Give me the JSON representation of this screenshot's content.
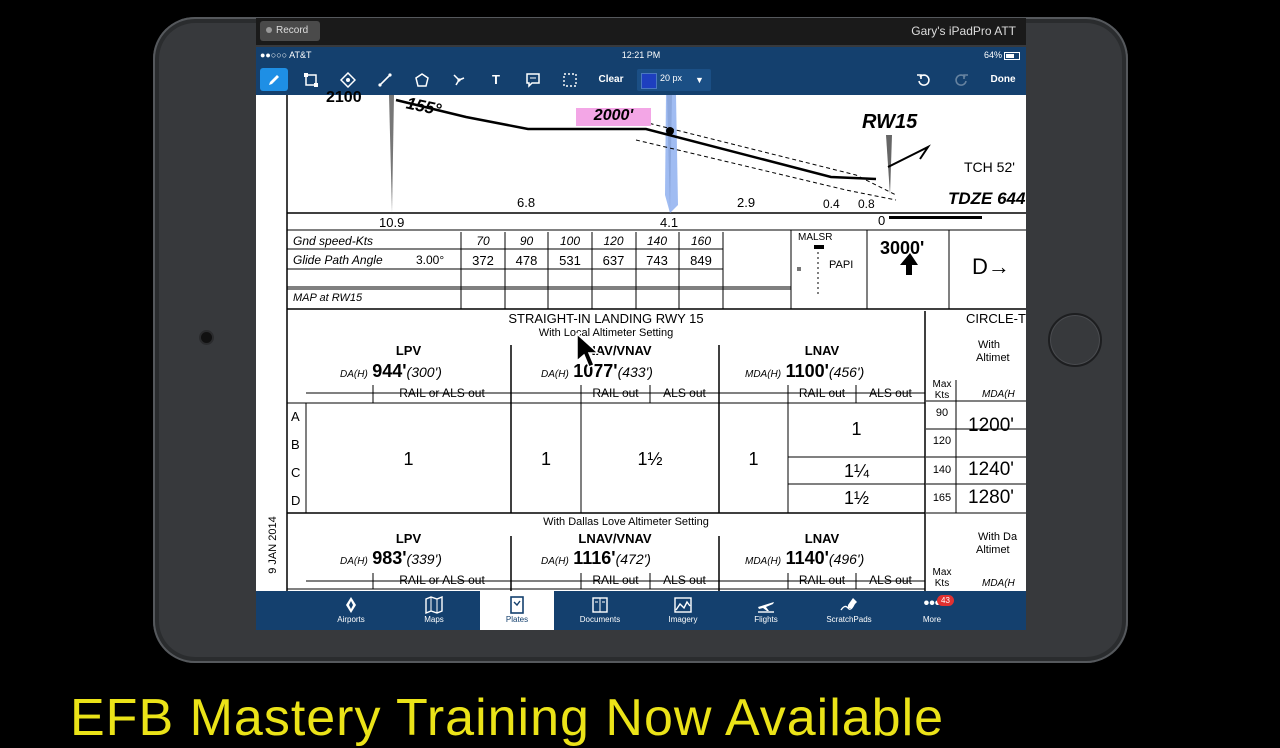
{
  "recorder": {
    "button_label": "Record",
    "device_name": "Gary's iPadPro ATT"
  },
  "status_bar": {
    "carrier": "●●○○○ AT&T",
    "time": "12:21 PM",
    "battery": "64%"
  },
  "toolbar": {
    "clear_label": "Clear",
    "stroke_width": "20 px",
    "done_label": "Done",
    "stroke_color": "#1e3fbf"
  },
  "plate": {
    "profile": {
      "alt_left": "2100",
      "course": "155°",
      "glideslope_alt": "2000'",
      "runway": "RW15",
      "tch": "TCH 52'",
      "tdze": "TDZE 644",
      "dist1": "6.8",
      "dist2": "2.9",
      "dist3": "0.4",
      "dist4": "0.8",
      "mile1": "10.9",
      "mile2": "4.1",
      "mile3": "0"
    },
    "speed_table": {
      "row1_label": "Gnd speed-Kts",
      "speeds": [
        "70",
        "90",
        "100",
        "120",
        "140",
        "160"
      ],
      "row2_label": "Glide Path Angle",
      "angle": "3.00°",
      "rates": [
        "372",
        "478",
        "531",
        "637",
        "743",
        "849"
      ],
      "row3_label": "MAP at RW15"
    },
    "lighting": {
      "malsr": "MALSR",
      "papi": "PAPI"
    },
    "missed_alt": "3000'",
    "straight_in": {
      "title": "STRAIGHT-IN LANDING RWY 15",
      "subtitle": "With Local Altimeter Setting",
      "col_lpv": "LPV",
      "col_lnav_vnav": "LNAV/VNAV",
      "col_lnav": "LNAV",
      "da_h": "DA(H)",
      "mda_h": "MDA(H)",
      "lpv_min": "944'",
      "lpv_hat": "(300')",
      "lnavvnav_min": "1077'",
      "lnavvnav_hat": "(433')",
      "lnav_min": "1100'",
      "lnav_hat": "(456')",
      "rail_or_als": "RAIL or ALS out",
      "rail_out": "RAIL out",
      "als_out": "ALS out",
      "categories": [
        "A",
        "B",
        "C",
        "D"
      ],
      "vis_lpv": "1",
      "vis_lnavvnav_rail": "1",
      "vis_lnavvnav_als": "1½",
      "vis_lnav_rail": "1",
      "vis_lnav_als_ab": "1",
      "vis_lnav_als_c": "1¼",
      "vis_lnav_als_d": "1½"
    },
    "dallas": {
      "subtitle": "With Dallas Love Altimeter Setting",
      "lpv_min": "983'",
      "lpv_hat": "(339')",
      "lnavvnav_min": "1116'",
      "lnavvnav_hat": "(472')",
      "lnav_min": "1140'",
      "lnav_hat": "(496')"
    },
    "circling": {
      "title": "CIRCLE-T",
      "with_local": "With",
      "altimeter": "Altimet",
      "with_dallas": "With Da",
      "max_kts": "Max Kts",
      "mda_h": "MDA(H",
      "speeds": [
        "90",
        "120",
        "140",
        "165"
      ],
      "mins": [
        "1200'",
        "1240'",
        "1280'"
      ]
    },
    "date": "9 JAN 2014"
  },
  "tabs": [
    {
      "label": "Airports"
    },
    {
      "label": "Maps"
    },
    {
      "label": "Plates"
    },
    {
      "label": "Documents"
    },
    {
      "label": "Imagery"
    },
    {
      "label": "Flights"
    },
    {
      "label": "ScratchPads"
    },
    {
      "label": "More",
      "badge": "43"
    }
  ],
  "banner": "EFB Mastery Training Now Available"
}
